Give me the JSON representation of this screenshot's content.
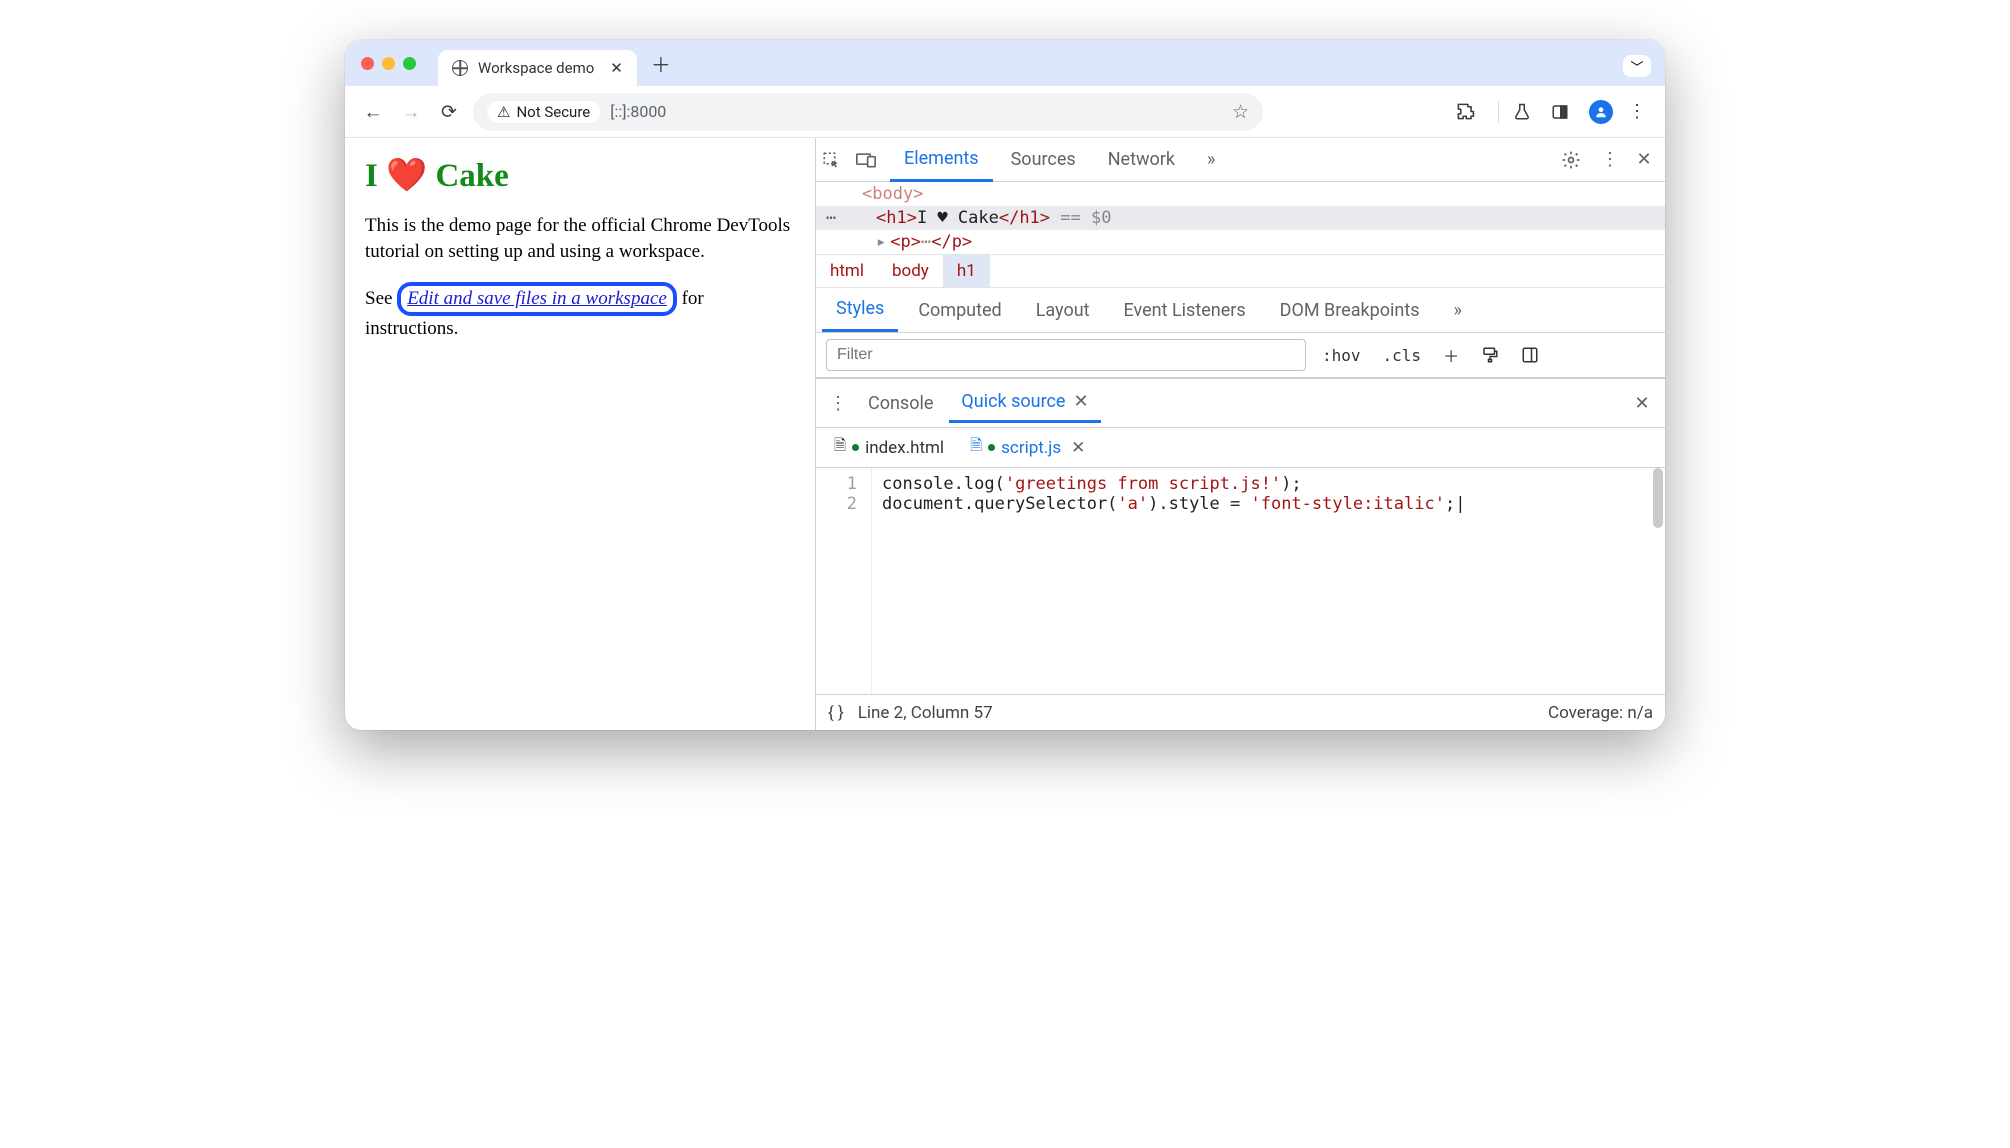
{
  "tab": {
    "title": "Workspace demo"
  },
  "omnibox": {
    "secure_label": "Not Secure",
    "address": "[::]:8000"
  },
  "page": {
    "h1_prefix": "I ",
    "h1_heart": "❤️",
    "h1_suffix": " Cake",
    "p1": "This is the demo page for the official Chrome DevTools tutorial on setting up and using a workspace.",
    "p2_before": "See ",
    "link_text": "Edit and save files in a workspace",
    "p2_after": " for instructions."
  },
  "devtools": {
    "tabs": {
      "elements": "Elements",
      "sources": "Sources",
      "network": "Network",
      "more": "»"
    },
    "dom": {
      "row0": "<body>",
      "row1_open": "<h1>",
      "row1_text": "I ♥ Cake",
      "row1_close": "</h1>",
      "row1_suffix": " == $0",
      "row2": "<p>…</p>"
    },
    "crumbs": [
      "html",
      "body",
      "h1"
    ],
    "styles_tabs": {
      "styles": "Styles",
      "computed": "Computed",
      "layout": "Layout",
      "event": "Event Listeners",
      "dom": "DOM Breakpoints",
      "more": "»"
    },
    "filter_placeholder": "Filter",
    "toolbar": {
      "hov": ":hov",
      "cls": ".cls"
    },
    "drawer": {
      "console": "Console",
      "quick": "Quick source"
    },
    "files": {
      "index": "index.html",
      "script": "script.js"
    },
    "code": {
      "lines": [
        "1",
        "2"
      ],
      "l1a": "console.log(",
      "l1b": "'greetings from script.js!'",
      "l1c": ");",
      "l2a": "document.querySelector(",
      "l2b": "'a'",
      "l2c": ").style = ",
      "l2d": "'font-style:italic'",
      "l2e": ";"
    },
    "status": {
      "pos": "Line 2, Column 57",
      "coverage": "Coverage: n/a"
    }
  }
}
